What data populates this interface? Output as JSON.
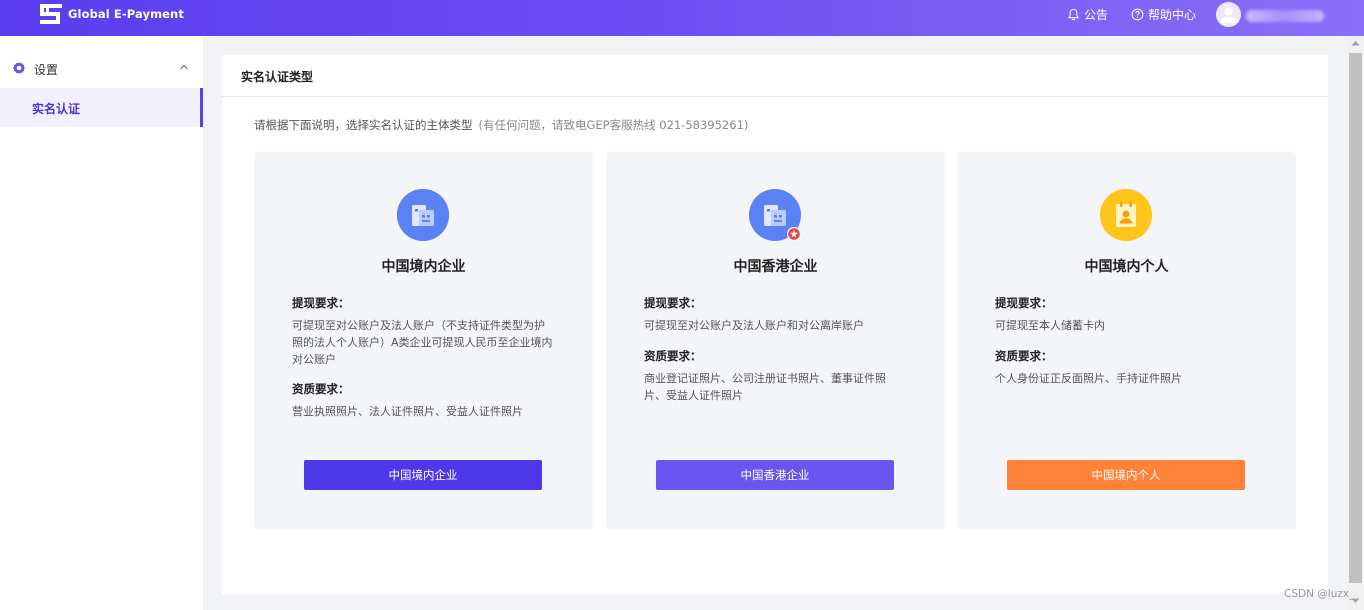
{
  "header": {
    "brand": "Global E-Payment",
    "notice_label": "公告",
    "help_label": "帮助中心",
    "accent_color": "#5b3df0"
  },
  "sidebar": {
    "group_label": "设置",
    "group_icon": "gear-icon",
    "items": [
      {
        "label": "实名认证",
        "active": true
      }
    ]
  },
  "main": {
    "panel_title": "实名认证类型",
    "hint": "请根据下面说明，选择实名认证的主体类型",
    "hint_sub": "(有任何问题，请致电GEP客服热线 021-58395261)",
    "cards": [
      {
        "title": "中国境内企业",
        "icon": "building-icon",
        "withdraw_title": "提现要求：",
        "withdraw_text": "可提现至对公账户及法人账户（不支持证件类型为护照的法人个人账户）A类企业可提现人民币至企业境内对公账户",
        "qual_title": "资质要求：",
        "qual_text": "营业执照照片、法人证件照片、受益人证件照片",
        "button": "中国境内企业",
        "button_color": "#4f37ea"
      },
      {
        "title": "中国香港企业",
        "icon": "building-hk-icon",
        "withdraw_title": "提现要求：",
        "withdraw_text": "可提现至对公账户及法人账户和对公离岸账户",
        "qual_title": "资质要求：",
        "qual_text": "商业登记证照片、公司注册证书照片、董事证件照片、受益人证件照片",
        "button": "中国香港企业",
        "button_color": "#6a55f3"
      },
      {
        "title": "中国境内个人",
        "icon": "person-id-icon",
        "withdraw_title": "提现要求：",
        "withdraw_text": "可提现至本人储蓄卡内",
        "qual_title": "资质要求：",
        "qual_text": "个人身份证正反面照片、手持证件照片",
        "button": "中国境内个人",
        "button_color": "#ff8237"
      }
    ]
  },
  "watermark": "CSDN @luzx_"
}
